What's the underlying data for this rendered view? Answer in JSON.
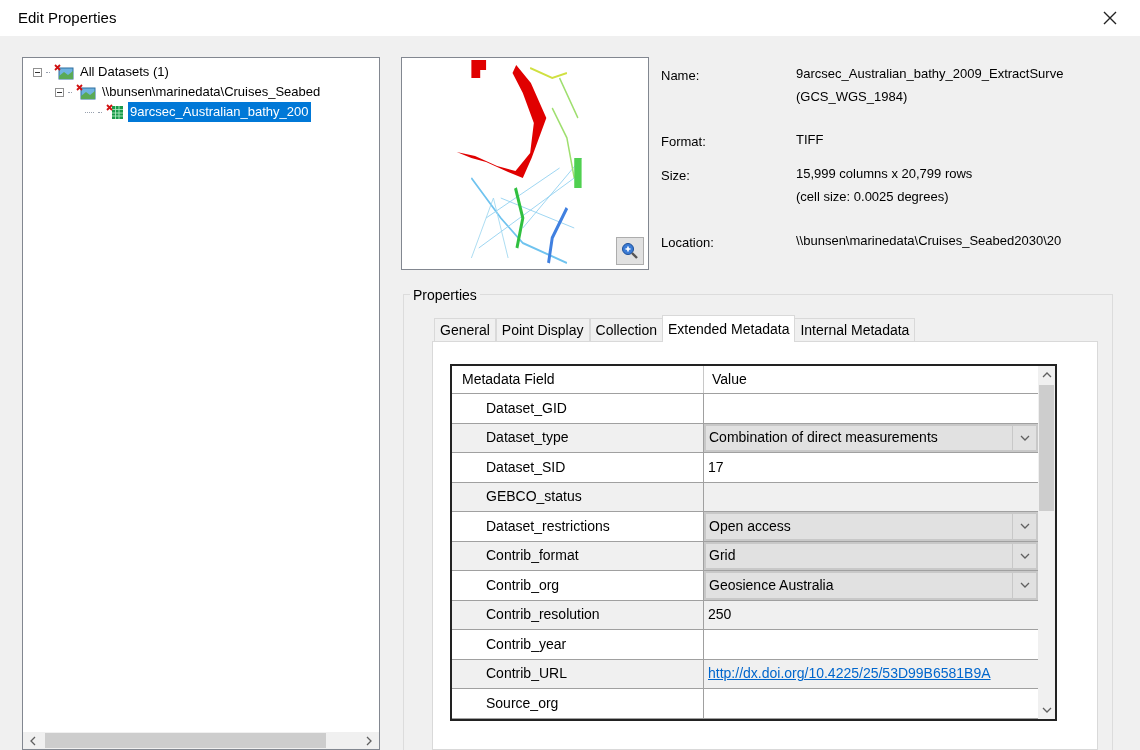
{
  "window": {
    "title": "Edit Properties"
  },
  "tree": [
    {
      "label": "All Datasets (1)",
      "expanded": true,
      "selected": false,
      "kind": "group",
      "children": [
        {
          "label": "\\\\bunsen\\marinedata\\Cruises_Seabed",
          "expanded": true,
          "selected": false,
          "kind": "group",
          "children": [
            {
              "label": "9arcsec_Australian_bathy_200",
              "selected": true,
              "kind": "grid"
            }
          ]
        }
      ]
    }
  ],
  "info": [
    {
      "label": "Name:",
      "lines": [
        "9arcsec_Australian_bathy_2009_ExtractSurve",
        "(GCS_WGS_1984)"
      ]
    },
    {
      "label": "Format:",
      "lines": [
        "TIFF"
      ]
    },
    {
      "label": "Size:",
      "lines": [
        "15,999 columns x 20,799 rows",
        "(cell size: 0.0025 degrees)"
      ]
    },
    {
      "label": "Location:",
      "lines": [
        "\\\\bunsen\\marinedata\\Cruises_Seabed2030\\20"
      ]
    }
  ],
  "properties": {
    "title": "Properties",
    "tabs": [
      {
        "label": "General",
        "selected": false
      },
      {
        "label": "Point Display",
        "selected": false
      },
      {
        "label": "Collection",
        "selected": false
      },
      {
        "label": "Extended Metadata",
        "selected": true
      },
      {
        "label": "Internal Metadata",
        "selected": false
      }
    ],
    "table": {
      "columns": [
        "Metadata Field",
        "Value"
      ],
      "rows": [
        {
          "field": "Dataset_GID",
          "kind": "text",
          "value": ""
        },
        {
          "field": "Dataset_type",
          "kind": "dropdown",
          "value": "Combination of direct measurements"
        },
        {
          "field": "Dataset_SID",
          "kind": "text",
          "value": "17"
        },
        {
          "field": "GEBCO_status",
          "kind": "text",
          "value": ""
        },
        {
          "field": "Dataset_restrictions",
          "kind": "dropdown",
          "value": "Open access"
        },
        {
          "field": "Contrib_format",
          "kind": "dropdown",
          "value": "Grid"
        },
        {
          "field": "Contrib_org",
          "kind": "dropdown",
          "value": "Geosience Australia"
        },
        {
          "field": "Contrib_resolution",
          "kind": "text",
          "value": "250"
        },
        {
          "field": "Contrib_year",
          "kind": "text",
          "value": ""
        },
        {
          "field": "Contrib_URL",
          "kind": "link",
          "value": "http://dx.doi.org/10.4225/25/53D99B6581B9A"
        },
        {
          "field": "Source_org",
          "kind": "text",
          "value": ""
        }
      ]
    }
  }
}
